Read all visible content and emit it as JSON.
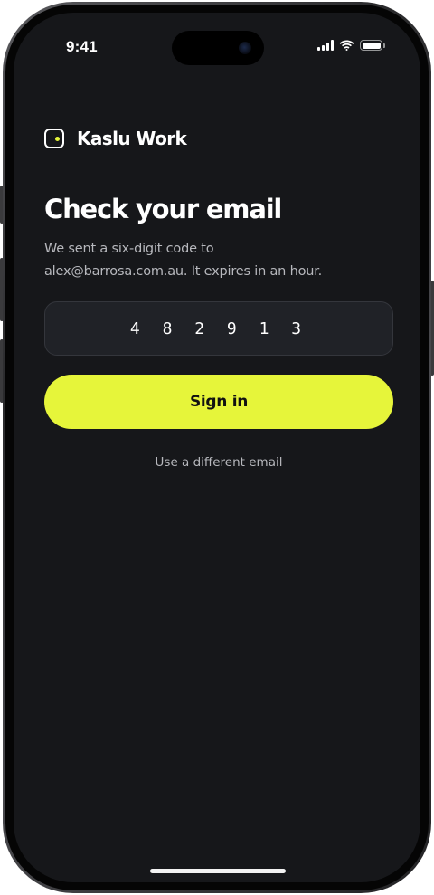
{
  "status_bar": {
    "time": "9:41"
  },
  "brand": {
    "name": "Kaslu Work"
  },
  "screen": {
    "title": "Check your email",
    "subtitle_line1": "We sent a six-digit code to",
    "subtitle_line2": "alex@barrosa.com.au. It expires in an hour.",
    "code_value": "482913",
    "code_display": "4 8 2 9 1 3",
    "signin_label": "Sign in",
    "alt_link_label": "Use a different email"
  },
  "colors": {
    "background": "#16171a",
    "accent": "#e6f53a",
    "field": "#202227",
    "muted_text": "#b7b8bd"
  },
  "icons": {
    "brand_logo": "rounded-square-with-dot-icon",
    "signal": "cellular-signal-icon",
    "wifi": "wifi-icon",
    "battery": "battery-icon"
  }
}
